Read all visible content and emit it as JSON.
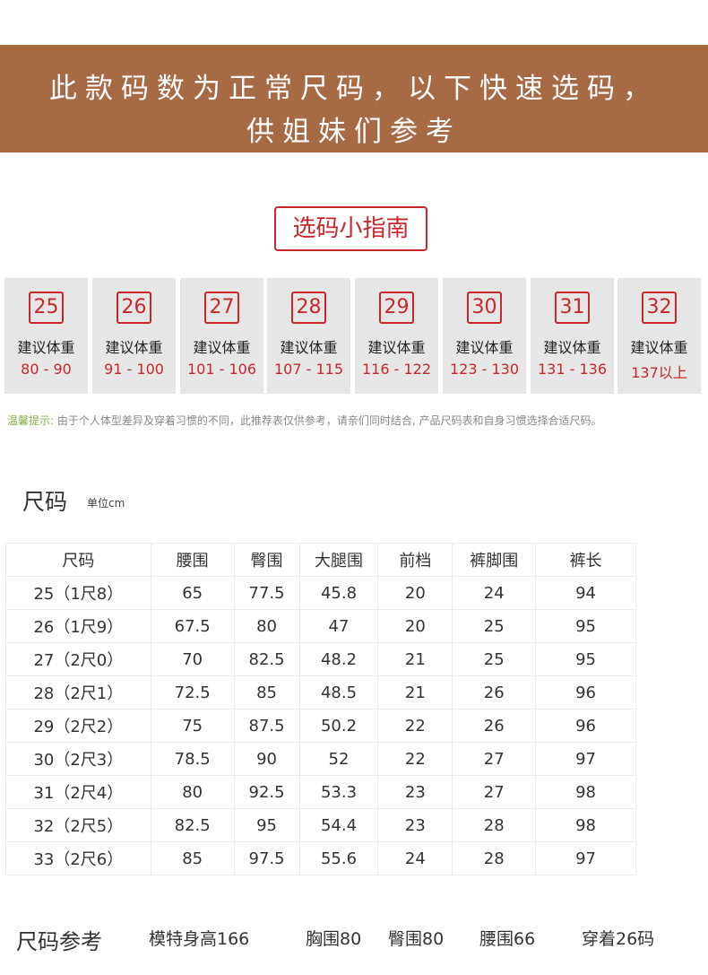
{
  "banner": {
    "line1": "此款码数为正常尺码，以下快速选码，",
    "line2": "供姐妹们参考"
  },
  "guide": {
    "title": "选码小指南"
  },
  "sizes": [
    {
      "size": "25",
      "label": "建议体重",
      "range": "80 - 90"
    },
    {
      "size": "26",
      "label": "建议体重",
      "range": "91 - 100"
    },
    {
      "size": "27",
      "label": "建议体重",
      "range": "101 - 106"
    },
    {
      "size": "28",
      "label": "建议体重",
      "range": "107 - 115"
    },
    {
      "size": "29",
      "label": "建议体重",
      "range": "116 - 122"
    },
    {
      "size": "30",
      "label": "建议体重",
      "range": "123 - 130"
    },
    {
      "size": "31",
      "label": "建议体重",
      "range": "131 - 136"
    },
    {
      "size": "32",
      "label": "建议体重",
      "range": "137以上"
    }
  ],
  "tip": {
    "label": "温馨提示:",
    "text": " 由于个人体型差异及穿着习惯的不同，此推荐表仅供参考，请亲们同时结合, 产品尺码表和自身习惯选择合适尺码。"
  },
  "measure": {
    "title": "尺码",
    "unit": "单位cm",
    "headers": [
      "尺码",
      "腰围",
      "臀围",
      "大腿围",
      "前档",
      "裤脚围",
      "裤长"
    ],
    "rows": [
      [
        "25（1尺8）",
        "65",
        "77.5",
        "45.8",
        "20",
        "24",
        "94"
      ],
      [
        "26（1尺9）",
        "67.5",
        "80",
        "47",
        "20",
        "25",
        "95"
      ],
      [
        "27（2尺0）",
        "70",
        "82.5",
        "48.2",
        "21",
        "25",
        "95"
      ],
      [
        "28（2尺1）",
        "72.5",
        "85",
        "48.5",
        "21",
        "26",
        "96"
      ],
      [
        "29（2尺2）",
        "75",
        "87.5",
        "50.2",
        "22",
        "26",
        "96"
      ],
      [
        "30（2尺3）",
        "78.5",
        "90",
        "52",
        "22",
        "27",
        "97"
      ],
      [
        "31（2尺4）",
        "80",
        "92.5",
        "53.3",
        "23",
        "27",
        "98"
      ],
      [
        "32（2尺5）",
        "82.5",
        "95",
        "54.4",
        "23",
        "28",
        "98"
      ],
      [
        "33（2尺6）",
        "85",
        "97.5",
        "55.6",
        "24",
        "28",
        "97"
      ]
    ]
  },
  "reference": {
    "title": "尺码参考",
    "height": "模特身高166",
    "chest": "胸围80",
    "hip": "臀围80",
    "waist": "腰围66",
    "wearing": "穿着26码"
  },
  "colors": {
    "banner": "#a86a43",
    "accent_red": "#c8282c",
    "card_bg": "#e6e6e6",
    "tip_green": "#8bb04a"
  }
}
